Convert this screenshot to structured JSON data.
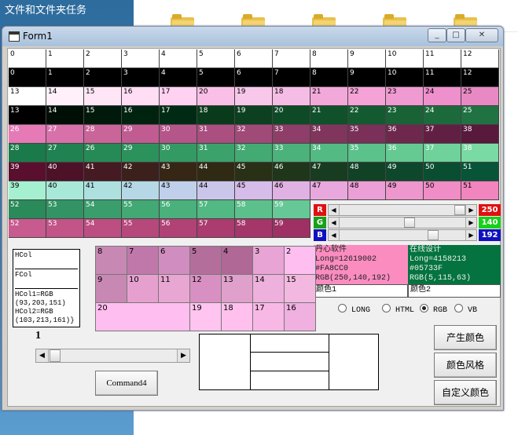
{
  "desktop": {
    "title": "文件和文件夹任务"
  },
  "window": {
    "title": "Form1",
    "min_glyph": "_",
    "max_glyph": "□",
    "close_glyph": "✕"
  },
  "grid_rows": [
    {
      "cells": [
        "0",
        "1",
        "2",
        "3",
        "4",
        "5",
        "6",
        "7",
        "8",
        "9",
        "10",
        "11",
        "12"
      ],
      "bg": [
        "#ffffff",
        "#ffffff",
        "#ffffff",
        "#ffffff",
        "#ffffff",
        "#ffffff",
        "#ffffff",
        "#ffffff",
        "#ffffff",
        "#ffffff",
        "#ffffff",
        "#ffffff",
        "#ffffff"
      ],
      "fg": "#000000"
    },
    {
      "cells": [
        "0",
        "1",
        "2",
        "3",
        "4",
        "5",
        "6",
        "7",
        "8",
        "9",
        "10",
        "11",
        "12"
      ],
      "bg": [
        "#000000",
        "#000000",
        "#000000",
        "#000000",
        "#000000",
        "#000000",
        "#000000",
        "#000000",
        "#000000",
        "#000000",
        "#000000",
        "#000000",
        "#000000"
      ],
      "fg": "#ffffff"
    },
    {
      "cells": [
        "13",
        "14",
        "15",
        "16",
        "17",
        "20",
        "19",
        "18",
        "21",
        "22",
        "23",
        "24",
        "25"
      ],
      "bg": [
        "#ffffff",
        "#fff0fa",
        "#ffe6f7",
        "#ffddf5",
        "#ffd2f2",
        "#f9bfe6",
        "#f7c8ea",
        "#f5bde6",
        "#f3a8da",
        "#f5a3d6",
        "#f09ad2",
        "#ee90cc",
        "#e889c4"
      ],
      "fg": "#000000"
    },
    {
      "cells": [
        "13",
        "14",
        "15",
        "16",
        "17",
        "18",
        "19",
        "20",
        "21",
        "22",
        "23",
        "24",
        "25"
      ],
      "bg": [
        "#000000",
        "#000f05",
        "#00190a",
        "#002310",
        "#002a14",
        "#0a3a1c",
        "#0c4020",
        "#0e4a26",
        "#10502a",
        "#145a30",
        "#186236",
        "#1c6a3c",
        "#207242"
      ],
      "fg": "#ffffff"
    },
    {
      "cells": [
        "26",
        "27",
        "28",
        "29",
        "30",
        "31",
        "32",
        "33",
        "34",
        "35",
        "36",
        "37",
        "38"
      ],
      "bg": [
        "#e57ab6",
        "#d870aa",
        "#c96599",
        "#c05c92",
        "#b4568a",
        "#aa4f80",
        "#a04a78",
        "#8e3e68",
        "#80355c",
        "#7a3058",
        "#6e284e",
        "#621f44",
        "#58193c"
      ],
      "fg": "#ffffff"
    },
    {
      "cells": [
        "28",
        "27",
        "26",
        "29",
        "30",
        "31",
        "32",
        "33",
        "34",
        "35",
        "36",
        "37",
        "38"
      ],
      "bg": [
        "#1a7a4a",
        "#208250",
        "#268a56",
        "#2c925c",
        "#349a64",
        "#3aa26a",
        "#42aa72",
        "#4ab27a",
        "#52ba82",
        "#5ac28a",
        "#64ca92",
        "#6ed29a",
        "#7adaa4"
      ],
      "fg": "#ffffff"
    },
    {
      "cells": [
        "39",
        "40",
        "41",
        "42",
        "43",
        "44",
        "45",
        "46",
        "47",
        "48",
        "49",
        "50",
        "51"
      ],
      "bg": [
        "#5a0f2e",
        "#4e1228",
        "#461a22",
        "#3c201c",
        "#362616",
        "#302a14",
        "#283016",
        "#20361a",
        "#183c20",
        "#124226",
        "#0e482c",
        "#0a4e32",
        "#085438"
      ],
      "fg": "#ffffff"
    },
    {
      "cells": [
        "39",
        "40",
        "41",
        "42",
        "43",
        "44",
        "45",
        "46",
        "47",
        "48",
        "49",
        "50",
        "51"
      ],
      "bg": [
        "#a5f0d0",
        "#a8e8d8",
        "#aee0e0",
        "#b6d8e6",
        "#c0d0ea",
        "#cac6ea",
        "#d6bce8",
        "#e0b2e4",
        "#e8a8de",
        "#ec9ed6",
        "#ee96ce",
        "#f08cc6",
        "#f284be"
      ],
      "fg": "#000000"
    },
    {
      "cells": [
        "52",
        "53",
        "54",
        "55",
        "56",
        "57",
        "58",
        "59"
      ],
      "bg": [
        "#2a8a5a",
        "#329464",
        "#3a9e6c",
        "#42a874",
        "#4ab07c",
        "#52b884",
        "#5cc08c",
        "#66c896"
      ],
      "fg": "#ffffff"
    },
    {
      "cells": [
        "52",
        "53",
        "54",
        "55",
        "56",
        "57",
        "58",
        "59"
      ],
      "bg": [
        "#c75a8e",
        "#c25488",
        "#bc4e82",
        "#b6487c",
        "#b04276",
        "#aa3c70",
        "#a4366a",
        "#9e3064"
      ],
      "fg": "#ffffff"
    }
  ],
  "rgb": {
    "r": {
      "label": "R",
      "value": "250",
      "color": "#e01010",
      "level": 0.98
    },
    "g": {
      "label": "G",
      "value": "140",
      "color": "#18a018",
      "level": 0.55
    },
    "b": {
      "label": "B",
      "value": "192",
      "color": "#1010c0",
      "level": 0.75
    }
  },
  "swatch1": {
    "name": "丹心软件",
    "long": "Long=12619002",
    "hex": "#FA8CC0",
    "rgb": "RGB(250,140,192)",
    "caption": "颜色1",
    "color": "#fa8cc0"
  },
  "swatch2": {
    "name": "在线设计",
    "long": "Long=4158213",
    "hex": "#05733F",
    "rgb": "RGB(5,115,63)",
    "caption": "颜色2",
    "color": "#05733f"
  },
  "info": {
    "hcol": "HCol",
    "fcol": "FCol",
    "hcol1": "HCol1=RGB",
    "hcol1_val": "(93,203,151)",
    "hcol2": "HCol2=RGB",
    "hcol2_val": "(103,213,161)}"
  },
  "palette": [
    {
      "label": "8",
      "bg": "#c888b4"
    },
    {
      "label": "7",
      "bg": "#c078aa"
    },
    {
      "label": "6",
      "bg": "#d08ec0"
    },
    {
      "label": "5",
      "bg": "#b46e9c"
    },
    {
      "label": "4",
      "bg": "#b06896"
    },
    {
      "label": "3",
      "bg": "#e8a4d4"
    },
    {
      "label": "2",
      "bg": "#ffbef0"
    },
    {
      "label": "9",
      "bg": "#c888b4"
    },
    {
      "label": "10",
      "bg": "#e6a0d0"
    },
    {
      "label": "11",
      "bg": "#e8a6d2"
    },
    {
      "label": "12",
      "bg": "#d890c2"
    },
    {
      "label": "13",
      "bg": "#e0a0cc"
    },
    {
      "label": "14",
      "bg": "#eeb0dc"
    },
    {
      "label": "15",
      "bg": "#f2b8e0"
    },
    {
      "label": "20",
      "bg": "#ffbef0"
    },
    {
      "label": "19",
      "bg": "#ffc4f0"
    },
    {
      "label": "18",
      "bg": "#ffc0ee"
    },
    {
      "label": "17",
      "bg": "#f8b8e6"
    },
    {
      "label": "16",
      "bg": "#f0b0e0"
    }
  ],
  "radios": [
    {
      "label": "LONG",
      "checked": false
    },
    {
      "label": "HTML",
      "checked": false
    },
    {
      "label": "RGB",
      "checked": true
    },
    {
      "label": "VB",
      "checked": false
    }
  ],
  "counter": "1",
  "buttons": {
    "command4": "Command4",
    "generate": "产生颜色",
    "style": "颜色风格",
    "custom": "自定义颜色"
  }
}
